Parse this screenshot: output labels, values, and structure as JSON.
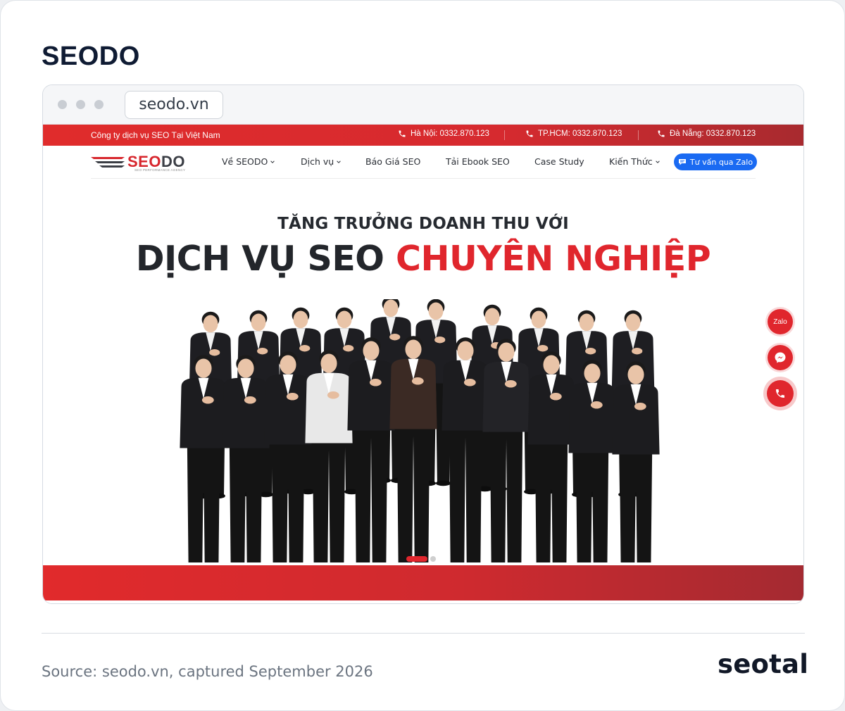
{
  "card": {
    "title": "SEODO",
    "source": "Source: seodo.vn, captured September 2026",
    "brand_logo": "seotal"
  },
  "browser": {
    "url": "seodo.vn"
  },
  "topbar": {
    "company": "Công ty dịch vụ SEO Tại Việt Nam",
    "phones": [
      {
        "label": "Hà Nội: 0332.870.123"
      },
      {
        "label": "TP.HCM: 0332.870.123"
      },
      {
        "label": "Đà Nẵng: 0332.870.123"
      }
    ]
  },
  "logo": {
    "seo": "SEO",
    "do": "DO",
    "tagline": "SEO PERFORMANCE AGENCY"
  },
  "nav": {
    "items": [
      {
        "label": "Về SEODO",
        "dropdown": true
      },
      {
        "label": "Dịch vụ",
        "dropdown": true
      },
      {
        "label": "Báo Giá SEO",
        "dropdown": false
      },
      {
        "label": "Tải Ebook SEO",
        "dropdown": false
      },
      {
        "label": "Case Study",
        "dropdown": false
      },
      {
        "label": "Kiến Thức",
        "dropdown": true
      }
    ],
    "cta": "Tư vấn qua Zalo"
  },
  "hero": {
    "subtitle": "TĂNG TRƯỞNG DOANH THU VỚI",
    "title_main": "DỊCH VỤ SEO ",
    "title_accent": "CHUYÊN NGHIỆP"
  },
  "floating": {
    "zalo": "Zalo"
  },
  "colors": {
    "brand_red": "#e0262d",
    "cta_blue": "#1a6af2",
    "dark_text": "#23262b"
  }
}
